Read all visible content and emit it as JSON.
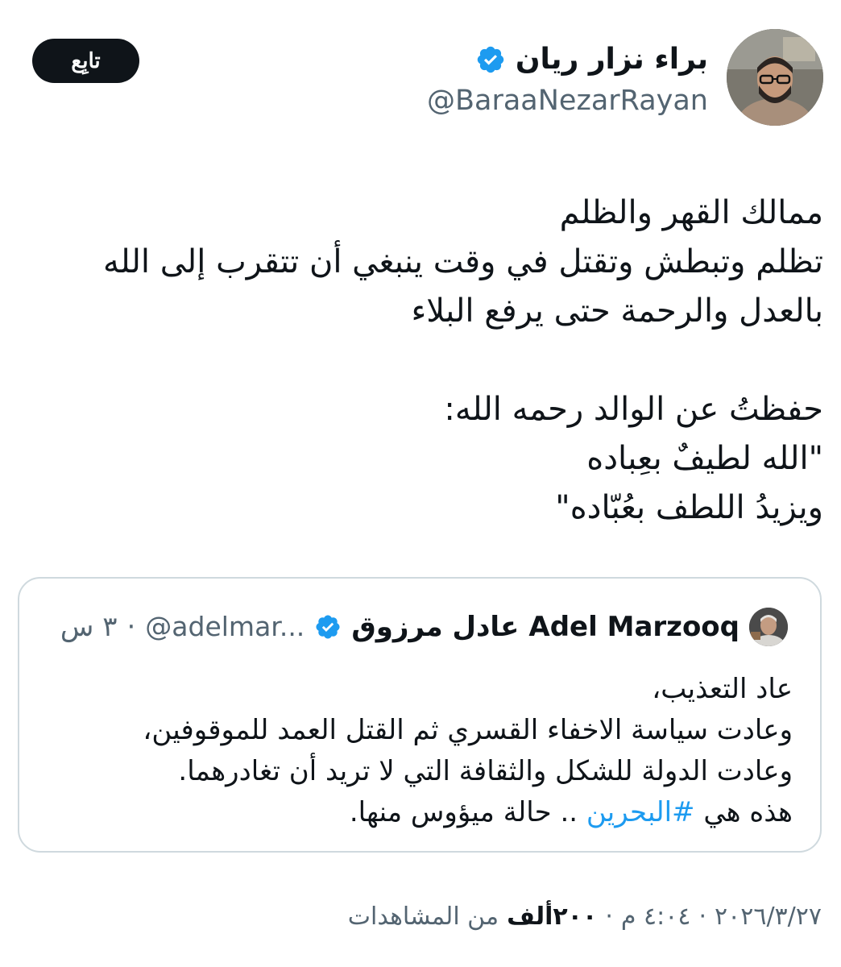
{
  "author": {
    "name": "براء نزار ريان",
    "handle": "@BaraaNezarRayan",
    "verified": true
  },
  "follow_button": {
    "label": "تابِع"
  },
  "tweet": {
    "lines": [
      "ممالك القهر والظلم",
      "تظلم وتبطش وتقتل في وقت ينبغي أن تتقرب إلى الله",
      "بالعدل والرحمة حتى يرفع البلاء",
      "",
      "حفظتُ عن الوالد رحمه الله:",
      "\"الله لطيفٌ بعِباده",
      "ويزيدُ اللطف بعُبّاده\""
    ]
  },
  "quoted_tweet": {
    "name_ar": "عادل مرزوق",
    "name_en": "Adel Marzooq",
    "handle": "@adelmar...",
    "time": "٣ س",
    "separator": "·",
    "verified": true,
    "lines": [
      "عاد التعذيب،",
      "وعادت سياسة الاخفاء القسري ثم القتل العمد للموقوفين،",
      "وعادت الدولة للشكل والثقافة التي لا تريد أن تغادرهما."
    ],
    "last_line": {
      "prefix": "هذه هي ",
      "hashtag": "#البحرين",
      "suffix": " .. حالة ميؤوس منها."
    }
  },
  "meta": {
    "date": "٢٠٢٦/٣/٢٧",
    "time": "٤:٠٤ م",
    "separator": "·",
    "views_count": "٢٠٠ألف",
    "views_label": "من المشاهدات"
  },
  "colors": {
    "verified": "#1d9bf0",
    "hashtag": "#1d9bf0",
    "secondary_text": "#536471",
    "follow_bg": "#0f1419"
  }
}
